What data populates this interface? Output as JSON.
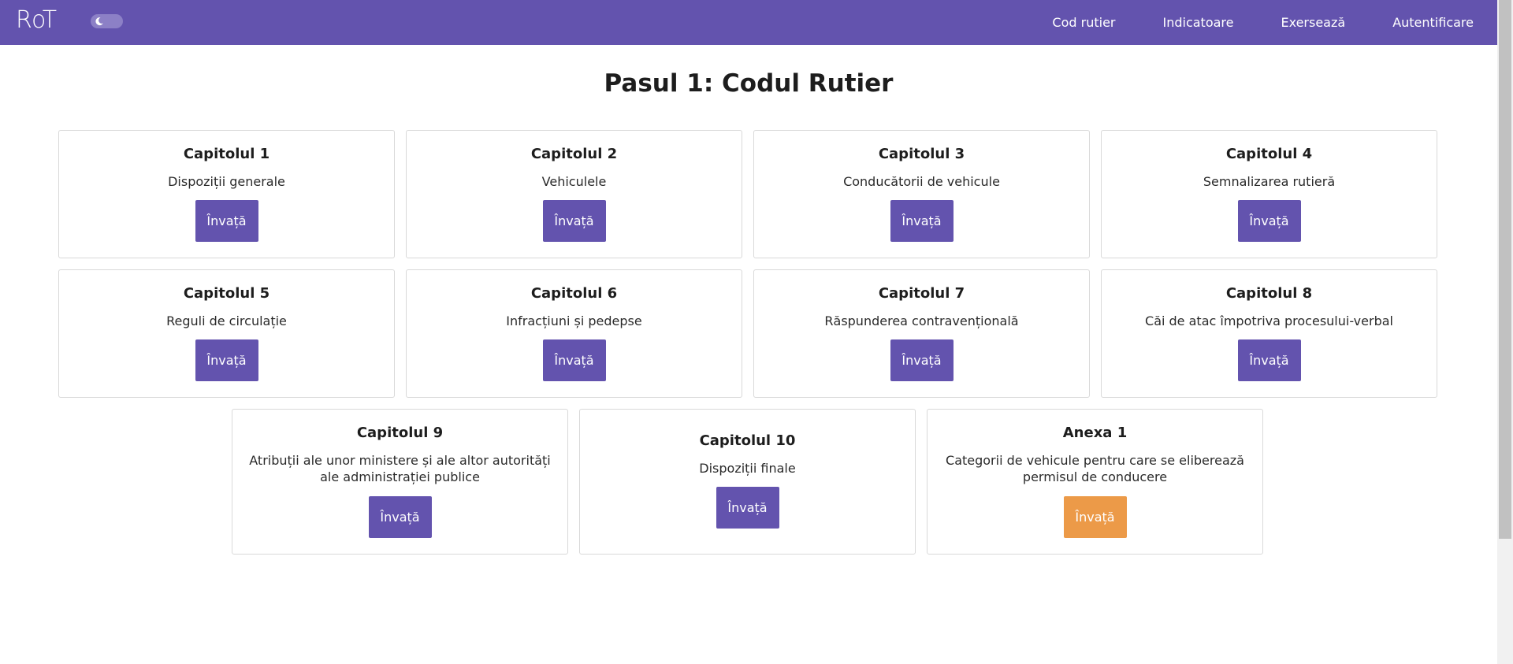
{
  "app": {
    "brand": "RoT"
  },
  "nav": {
    "theme_toggle_icon": "moon-icon",
    "links": [
      "Cod rutier",
      "Indicatoare",
      "Exersează",
      "Autentificare"
    ]
  },
  "main": {
    "title": "Pasul 1: Codul Rutier"
  },
  "cards": [
    {
      "title": "Capitolul 1",
      "text": "Dispoziții generale",
      "button": "Învață"
    },
    {
      "title": "Capitolul 2",
      "text": "Vehiculele",
      "button": "Învață"
    },
    {
      "title": "Capitolul 3",
      "text": "Conducătorii de vehicule",
      "button": "Învață"
    },
    {
      "title": "Capitolul 4",
      "text": "Semnalizarea rutieră",
      "button": "Învață"
    },
    {
      "title": "Capitolul 5",
      "text": "Reguli de circulație",
      "button": "Învață"
    },
    {
      "title": "Capitolul 6",
      "text": "Infracțiuni și pedepse",
      "button": "Învață"
    },
    {
      "title": "Capitolul 7",
      "text": "Răspunderea contravențională",
      "button": "Învață"
    },
    {
      "title": "Capitolul 8",
      "text": "Căi de atac împotriva procesului-verbal",
      "button": "Învață"
    },
    {
      "title": "Capitolul 9",
      "text": "Atribuții ale unor ministere și ale altor autorități ale administrației publice",
      "button": "Învață"
    },
    {
      "title": "Capitolul 10",
      "text": "Dispoziții finale",
      "button": "Învață"
    },
    {
      "title": "Anexa 1",
      "text": "Categorii de vehicule pentru care se eliberează permisul de conducere",
      "button": "Învață"
    }
  ],
  "colors": {
    "primary": "#6353ae",
    "accent": "#ec9a48"
  }
}
